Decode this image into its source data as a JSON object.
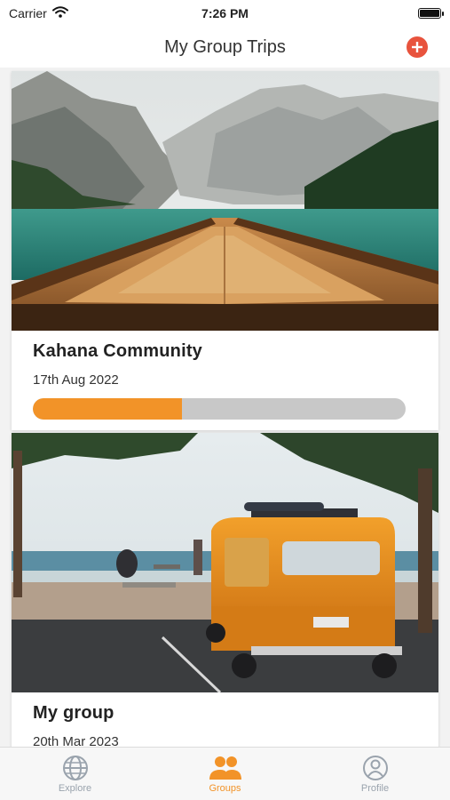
{
  "status_bar": {
    "carrier": "Carrier",
    "time": "7:26 PM"
  },
  "header": {
    "title": "My Group Trips",
    "add_icon": "plus-circle-icon"
  },
  "trips": [
    {
      "title": "Kahana Community",
      "date": "17th Aug 2022",
      "progress": 0.4,
      "image": "mountain-lake-boat-photo"
    },
    {
      "title": "My group",
      "date": "20th Mar 2023",
      "image": "orange-van-beach-photo"
    }
  ],
  "tabs": [
    {
      "label": "Explore",
      "icon": "globe-icon",
      "active": false
    },
    {
      "label": "Groups",
      "icon": "users-icon",
      "active": true
    },
    {
      "label": "Profile",
      "icon": "user-circle-icon",
      "active": false
    }
  ],
  "colors": {
    "accent": "#f29328",
    "add_button": "#e8533d",
    "inactive_tab": "#9aa3ad",
    "progress_track": "#c8c8c8"
  }
}
